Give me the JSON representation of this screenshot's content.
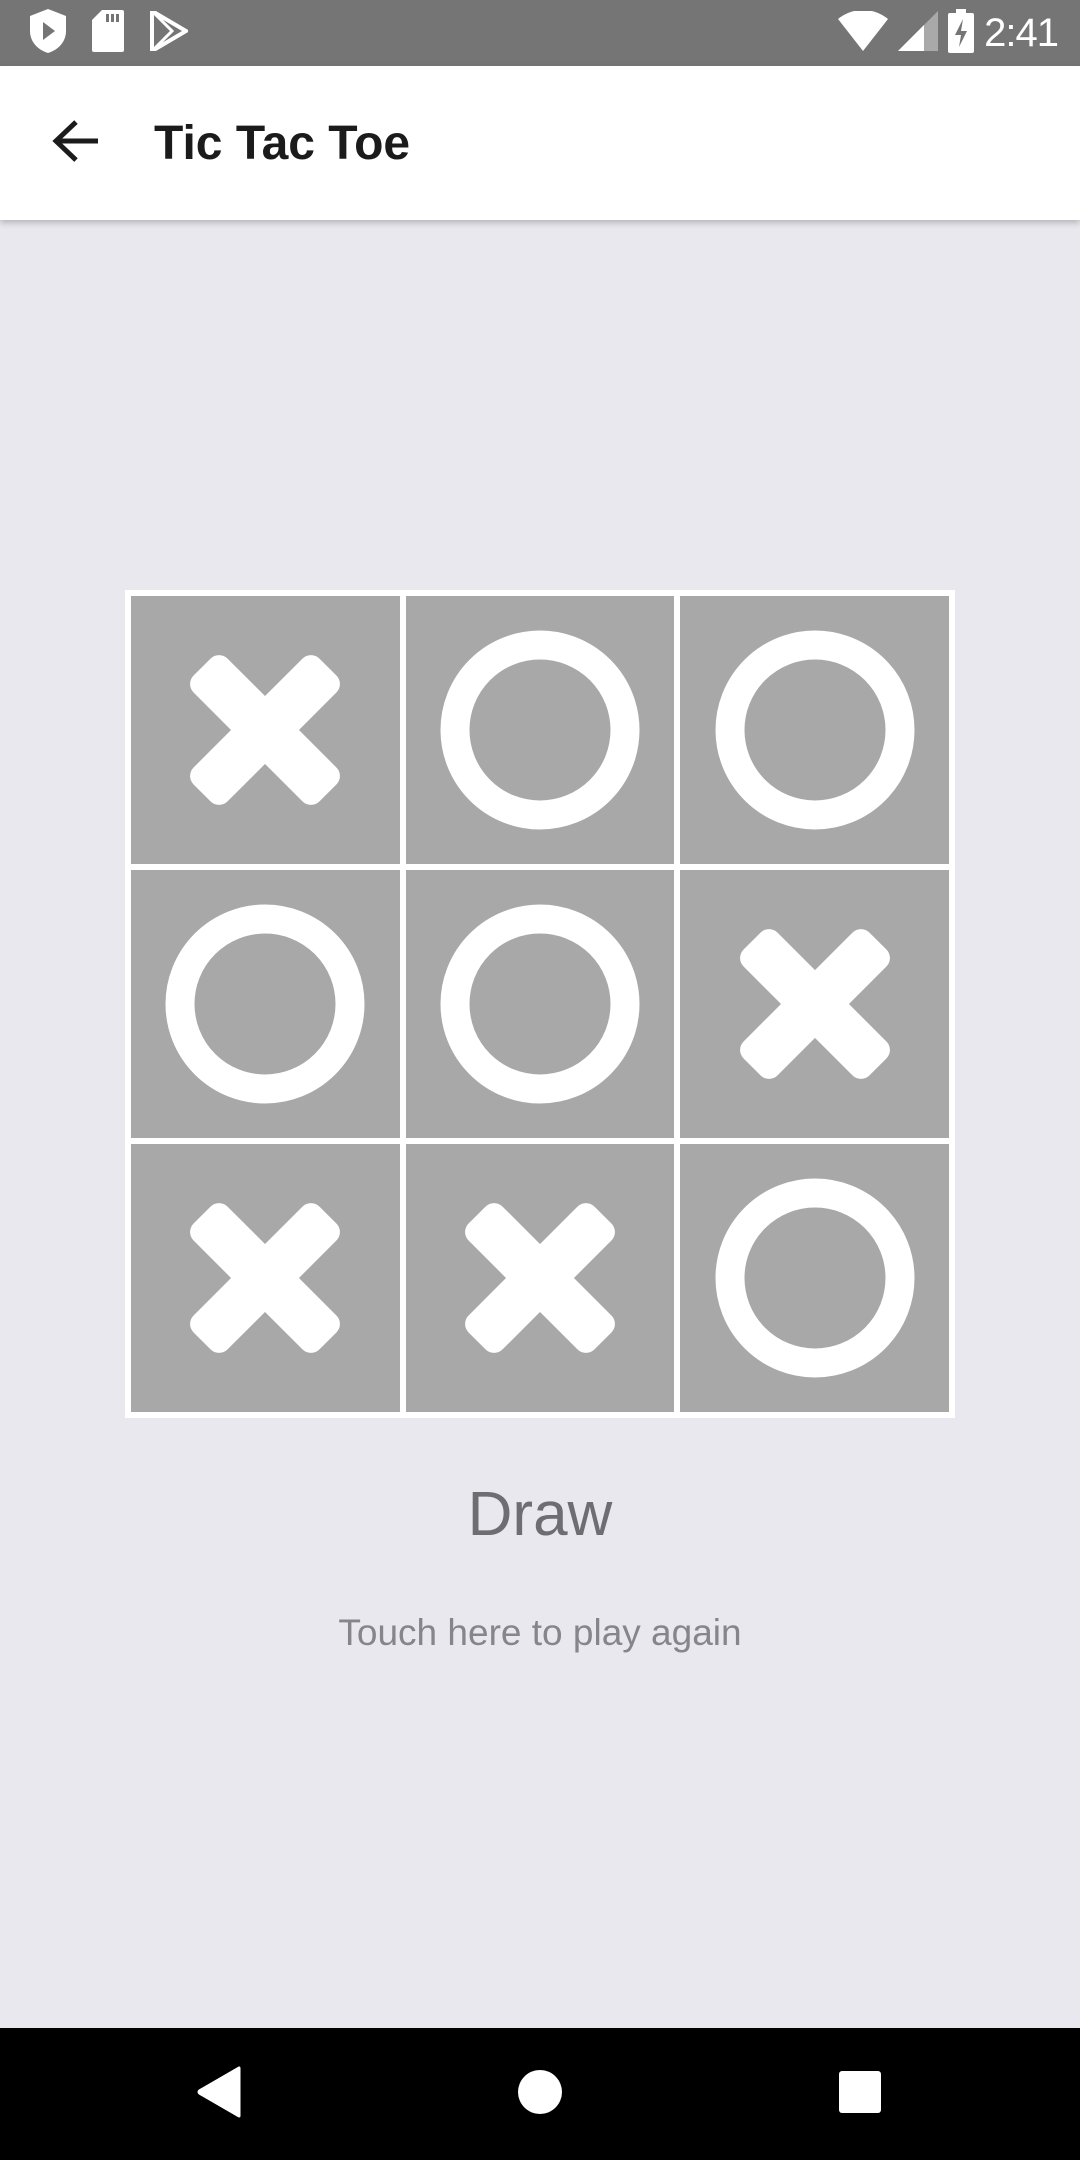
{
  "status_bar": {
    "time": "2:41",
    "left_icons": [
      "shield-play-icon",
      "sd-card-icon",
      "play-store-icon"
    ],
    "right_icons": [
      "wifi-icon",
      "cell-signal-icon",
      "battery-charging-icon"
    ]
  },
  "app_bar": {
    "back_icon": "arrow-left-icon",
    "title": "Tic Tac Toe"
  },
  "board": {
    "cells": [
      [
        "X",
        "O",
        "O"
      ],
      [
        "O",
        "O",
        "X"
      ],
      [
        "X",
        "X",
        "O"
      ]
    ],
    "colors": {
      "cell_bg": "#a8a8a8",
      "mark": "#ffffff",
      "grid_line": "#ffffff"
    }
  },
  "result": {
    "text": "Draw",
    "replay_prompt": "Touch here to play again"
  },
  "nav_bar": {
    "buttons": [
      "back",
      "home",
      "recents"
    ]
  },
  "colors": {
    "background": "#e9e8ee",
    "status_bar": "#757575",
    "app_bar": "#ffffff",
    "nav_bar": "#000000"
  }
}
